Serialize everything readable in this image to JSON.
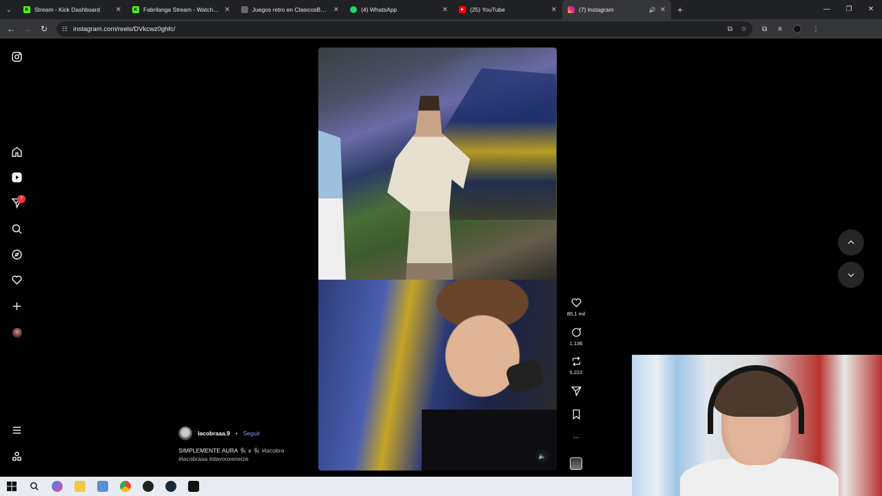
{
  "browser": {
    "tabs": [
      {
        "title": "Stream - Kick Dashboard",
        "icon": "kick-icon",
        "color": "#53fc18",
        "letter": "K",
        "active": false
      },
      {
        "title": "Fabrilanga Stream - Watch Live",
        "icon": "kick-icon",
        "color": "#53fc18",
        "letter": "K",
        "active": false
      },
      {
        "title": "Juegos retro en ClasicosBasicos",
        "icon": "retro-games-icon",
        "color": "#888888",
        "letter": "",
        "active": false
      },
      {
        "title": "(4) WhatsApp",
        "icon": "whatsapp-icon",
        "color": "#25d366",
        "letter": "",
        "active": false
      },
      {
        "title": "(25) YouTube",
        "icon": "youtube-icon",
        "color": "#ff0000",
        "letter": "",
        "active": false
      },
      {
        "title": "(7) Instagram",
        "icon": "instagram-icon",
        "color": "#e1306c",
        "letter": "",
        "active": true
      }
    ],
    "url": "instagram.com/reels/DVkcwz0ghfc/"
  },
  "sidebar": {
    "badge_count": "7",
    "items": [
      "instagram-logo-icon",
      "home-icon",
      "reels-icon",
      "direct-messages-icon",
      "search-icon",
      "explore-icon",
      "notifications-icon",
      "create-icon",
      "profile-icon",
      "menu-icon",
      "meta-icon"
    ]
  },
  "reel": {
    "username": "lacobraaa.9",
    "separator": "•",
    "follow_label": "Seguir",
    "caption": "SIMPLEMENTE AURA 🐈‍⬛ x 🐈‍⬛",
    "caption_tag_inline": "#lacobra",
    "caption_tags_line2": "#lacobraaa #davooxeneize",
    "likes": "85,1 mil",
    "comments": "1.136",
    "reposts": "5.222",
    "more_label": "..."
  },
  "colors": {
    "accent_link": "#8c9dff",
    "badge": "#ff3040",
    "background": "#000000"
  }
}
